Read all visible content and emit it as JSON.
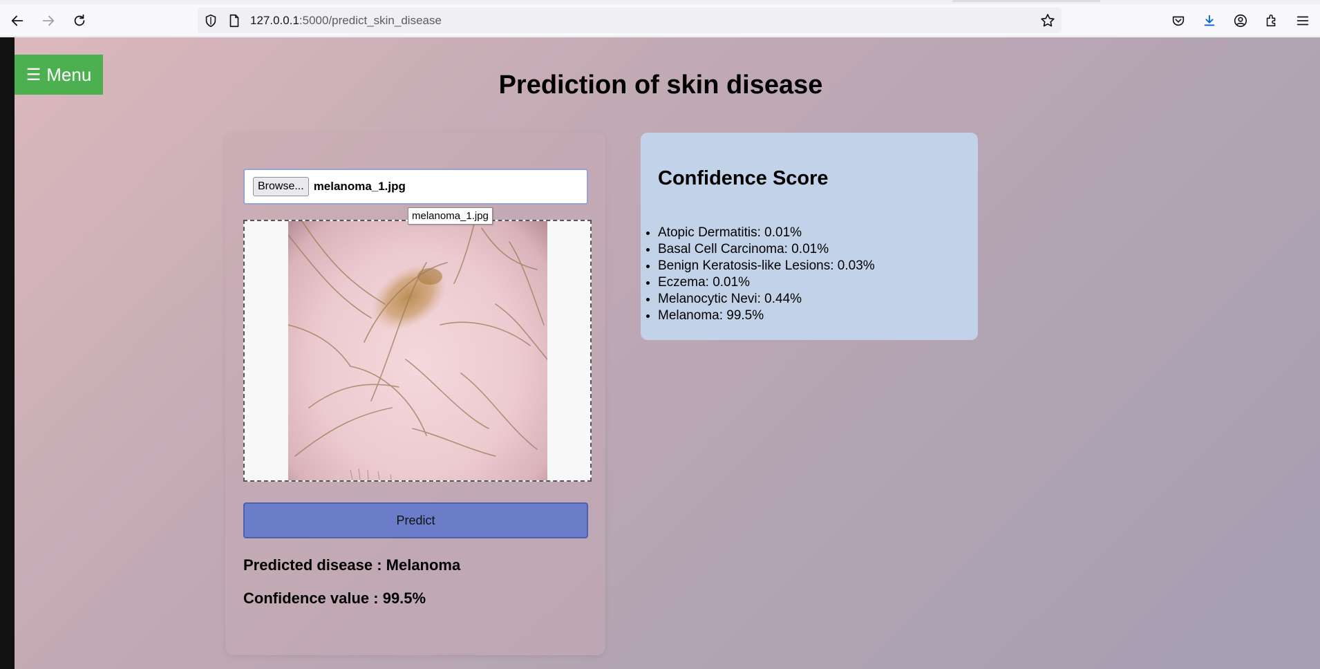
{
  "browser": {
    "url_host": "127.0.0.1",
    "url_path": ":5000/predict_skin_disease",
    "icons": [
      "back-icon",
      "forward-icon",
      "reload-icon",
      "shield-icon",
      "page-icon",
      "star-icon",
      "pocket-icon",
      "download-icon",
      "account-icon",
      "extensions-icon",
      "hamburger-menu-icon"
    ]
  },
  "menu": {
    "icon": "☰",
    "label": "Menu"
  },
  "page": {
    "title": "Prediction of skin disease"
  },
  "upload": {
    "browse_label": "Browse...",
    "file_name": "melanoma_1.jpg",
    "tooltip": "melanoma_1.jpg",
    "predict_label": "Predict",
    "predicted_disease": "Predicted disease : Melanoma",
    "confidence_value": "Confidence value : 99.5%"
  },
  "confidence": {
    "title": "Confidence Score",
    "items": [
      "Atopic Dermatitis: 0.01%",
      "Basal Cell Carcinoma: 0.01%",
      "Benign Keratosis-like Lesions: 0.03%",
      "Eczema: 0.01%",
      "Melanocytic Nevi: 0.44%",
      "Melanoma: 99.5%"
    ]
  },
  "colors": {
    "menu_green": "#4caf50",
    "predict_blue": "#6b7cc9",
    "confidence_card": "#c2d2e8"
  }
}
